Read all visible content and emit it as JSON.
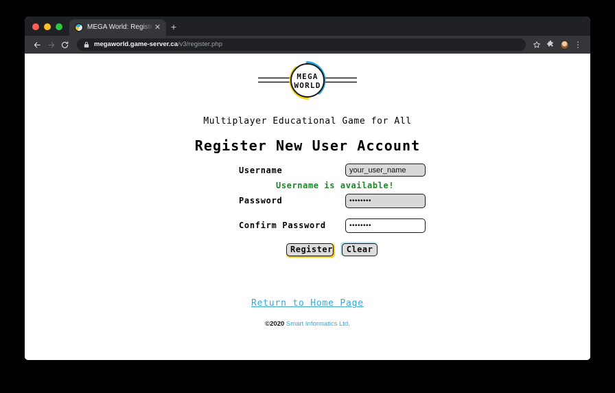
{
  "browser": {
    "traffic_lights": [
      "close",
      "minimize",
      "maximize"
    ],
    "tab": {
      "title": "MEGA World: Register New Ac",
      "favicon": "megaworld-favicon",
      "close_label": "✕"
    },
    "new_tab_label": "+",
    "nav": {
      "back_label": "back-arrow",
      "forward_label": "forward-arrow",
      "reload_label": "reload-arrow"
    },
    "omnibox": {
      "lock": "lock-icon",
      "domain": "megaworld.game-server.ca",
      "path": "/v3/register.php"
    },
    "actions": {
      "bookmark_label": "☆",
      "extensions_label": "extensions-puzzle",
      "profile_label": "profile-avatar",
      "menu_label": "⋮"
    },
    "colors": {
      "chrome_dark": "#35363a",
      "tabstrip_dark": "#202124",
      "omnibox_dark": "#202124"
    }
  },
  "page": {
    "logo": {
      "line1": "MEGA",
      "line2": "WORLD",
      "arc_top_color": "#29a8dd",
      "arc_bottom_color": "#f2d10a"
    },
    "tagline": "Multiplayer Educational Game for All",
    "title": "Register New User Account",
    "form": {
      "username": {
        "label": "Username",
        "value": "your_user_name",
        "placeholder": "your_user_name",
        "availability_message": "Username is available!",
        "availability_color": "#1a8a23"
      },
      "password": {
        "label": "Password",
        "value": "••••••••",
        "placeholder": ""
      },
      "confirm_password": {
        "label": "Confirm Password",
        "value": "••••••••",
        "placeholder": ""
      },
      "register_button": "Register",
      "clear_button": "Clear"
    },
    "footer": {
      "home_link": "Return to Home Page",
      "copyright_year": "©2020",
      "company": "Smart Informatics Ltd.",
      "link_color": "#3aa8d8"
    }
  }
}
